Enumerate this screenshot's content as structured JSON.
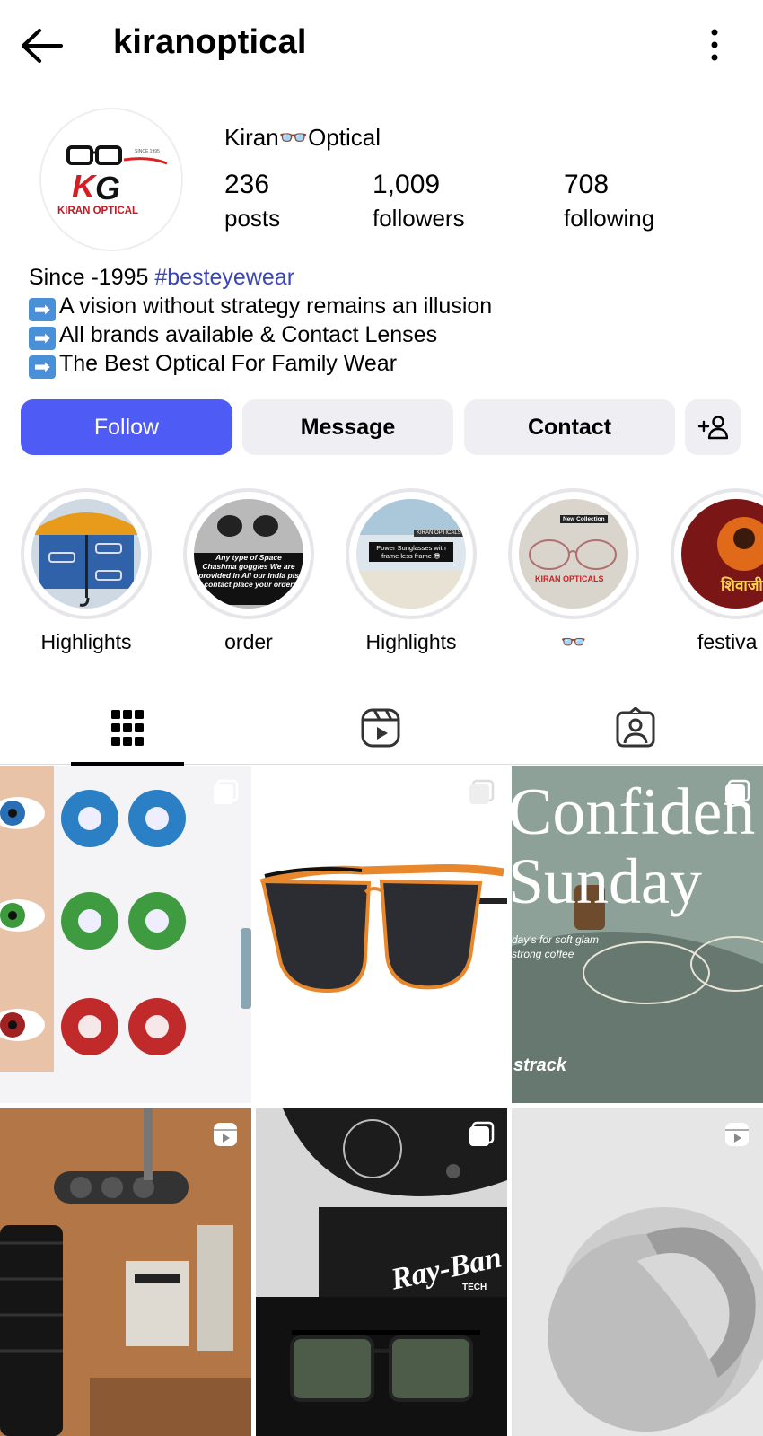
{
  "header": {
    "username": "kiranoptical"
  },
  "profile": {
    "display_name": "Kiran👓Optical",
    "avatar_text": "KIRAN OPTICAL",
    "avatar_badge": "SINCE 1995",
    "stats": [
      {
        "value": "236",
        "label": "posts"
      },
      {
        "value": "1,009",
        "label": "followers"
      },
      {
        "value": "708",
        "label": "following"
      }
    ]
  },
  "bio": {
    "line1_text": "Since -1995 ",
    "line1_tag": "#besteyewear",
    "arrow": "➡",
    "line2": "A vision without strategy remains an illusion",
    "line3": "All brands available & Contact Lenses",
    "line4": "The Best Optical For Family Wear"
  },
  "actions": {
    "follow": "Follow",
    "message": "Message",
    "contact": "Contact"
  },
  "highlights": [
    {
      "label": "Highlights"
    },
    {
      "label": "order",
      "text": "Any type of Space Chashma goggles We are provided in All our India pls contact place your order"
    },
    {
      "label": "Highlights",
      "text": "Power Sunglasses with frame less frame 😎",
      "badge": "KIRAN OPTICALS"
    },
    {
      "label": "👓",
      "text": "KIRAN OPTICALS",
      "badge": "New Collection"
    },
    {
      "label": "festiva",
      "text": "शिवाजी"
    }
  ],
  "tabs": [
    "posts-grid",
    "reels",
    "tagged"
  ],
  "posts": [
    {
      "kind": "multi",
      "subject": "contact lenses"
    },
    {
      "kind": "multi",
      "subject": "sunglasses"
    },
    {
      "kind": "multi",
      "subject": "Confident Sunday",
      "text1": "Confiden",
      "text2": "Sunday",
      "text3": "day's for soft glam",
      "text4": "strong coffee",
      "brand": "strack"
    },
    {
      "kind": "reel",
      "subject": "eye test equipment"
    },
    {
      "kind": "multi",
      "subject": "Ray-Ban",
      "brand": "Ray-Ban",
      "brand_sub": "TECH"
    },
    {
      "kind": "reel",
      "subject": "3d sphere"
    }
  ]
}
